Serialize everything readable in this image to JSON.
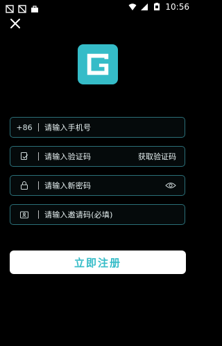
{
  "status_bar": {
    "time": "10:56",
    "icons": [
      "notification-icon",
      "notification-icon",
      "bag-icon",
      "wifi-icon",
      "signal-icon",
      "battery-icon"
    ]
  },
  "header": {
    "close_icon": "close-icon"
  },
  "logo": {
    "icon": "app-logo-icon",
    "color": "#35bcc8"
  },
  "form": {
    "phone": {
      "prefix": "+86",
      "placeholder": "请输入手机号"
    },
    "code": {
      "placeholder": "请输入验证码",
      "action": "获取验证码"
    },
    "password": {
      "placeholder": "请输入新密码",
      "toggle_icon": "eye-icon"
    },
    "invite": {
      "placeholder": "请输入邀请码(必填)"
    }
  },
  "actions": {
    "register": "立即注册"
  },
  "colors": {
    "accent": "#35bcc8",
    "field_border": "#2b6f78",
    "background": "#000000"
  }
}
